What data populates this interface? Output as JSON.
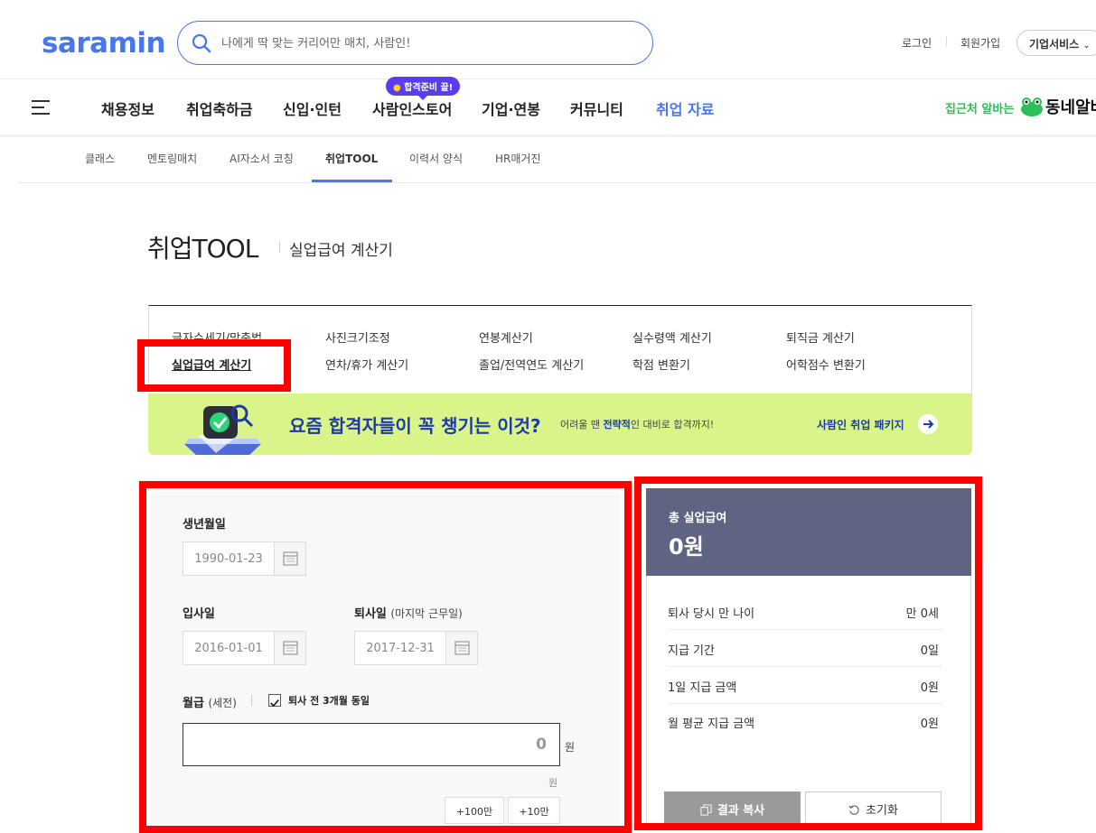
{
  "header": {
    "logo": "saramin",
    "search_placeholder": "나에게 딱 맞는 커리어만 매치, 사람인!",
    "login": "로그인",
    "signup": "회원가입",
    "corp_service": "기업서비스"
  },
  "gnb": {
    "items": [
      "채용정보",
      "취업축하금",
      "신입·인턴",
      "사람인스토어",
      "기업·연봉",
      "커뮤니티",
      "취업 자료"
    ],
    "badge": "합격준비 끝!",
    "alba_promo": "집근처 알바는",
    "alba_brand": "동네알바"
  },
  "subnav": {
    "items": [
      "클래스",
      "멘토링매치",
      "AI자소서 코칭",
      "취업TOOL",
      "이력서 양식",
      "HR매거진"
    ]
  },
  "page": {
    "title": "취업TOOL",
    "subtitle": "실업급여 계산기"
  },
  "tools": {
    "row1": [
      "글자수세기/맞춤법",
      "사진크기조정",
      "연봉계산기",
      "실수령액 계산기",
      "퇴직금 계산기"
    ],
    "row2": [
      "실업급여 계산기",
      "연차/휴가 계산기",
      "졸업/전역연도 계산기",
      "학점 변환기",
      "어학점수 변환기"
    ]
  },
  "banner": {
    "title": "요즘 합격자들이 꼭 챙기는 이것?",
    "sub_pre": "어려울 땐 ",
    "sub_bold": "전략적",
    "sub_post": "인 대비로 합격까지!",
    "link": "사람인 취업 패키지"
  },
  "form": {
    "birth_label": "생년월일",
    "birth_value": "1990-01-23",
    "join_label": "입사일",
    "join_value": "2016-01-01",
    "leave_label": "퇴사일",
    "leave_note": "(마지막 근무일)",
    "leave_value": "2017-12-31",
    "wage_label": "월급",
    "wage_note": "(세전)",
    "same_3months": "퇴사 전 3개월 동일",
    "wage_value": "0",
    "unit": "원",
    "add_100": "+100만",
    "add_10": "+10만"
  },
  "result": {
    "total_label": "총 실업급여",
    "total_value": "0원",
    "rows": [
      {
        "k": "퇴사 당시 만 나이",
        "v": "만 0세"
      },
      {
        "k": "지급 기간",
        "v": "0일"
      },
      {
        "k": "1일 지급 금액",
        "v": "0원"
      },
      {
        "k": "월 평균 지급 금액",
        "v": "0원"
      }
    ],
    "copy_btn": "결과 복사",
    "reset_btn": "초기화"
  },
  "colors": {
    "brand": "#4876ef",
    "highlight": "#ff0000",
    "banner_bg": "#d9f58a",
    "result_head": "#5f6482"
  }
}
